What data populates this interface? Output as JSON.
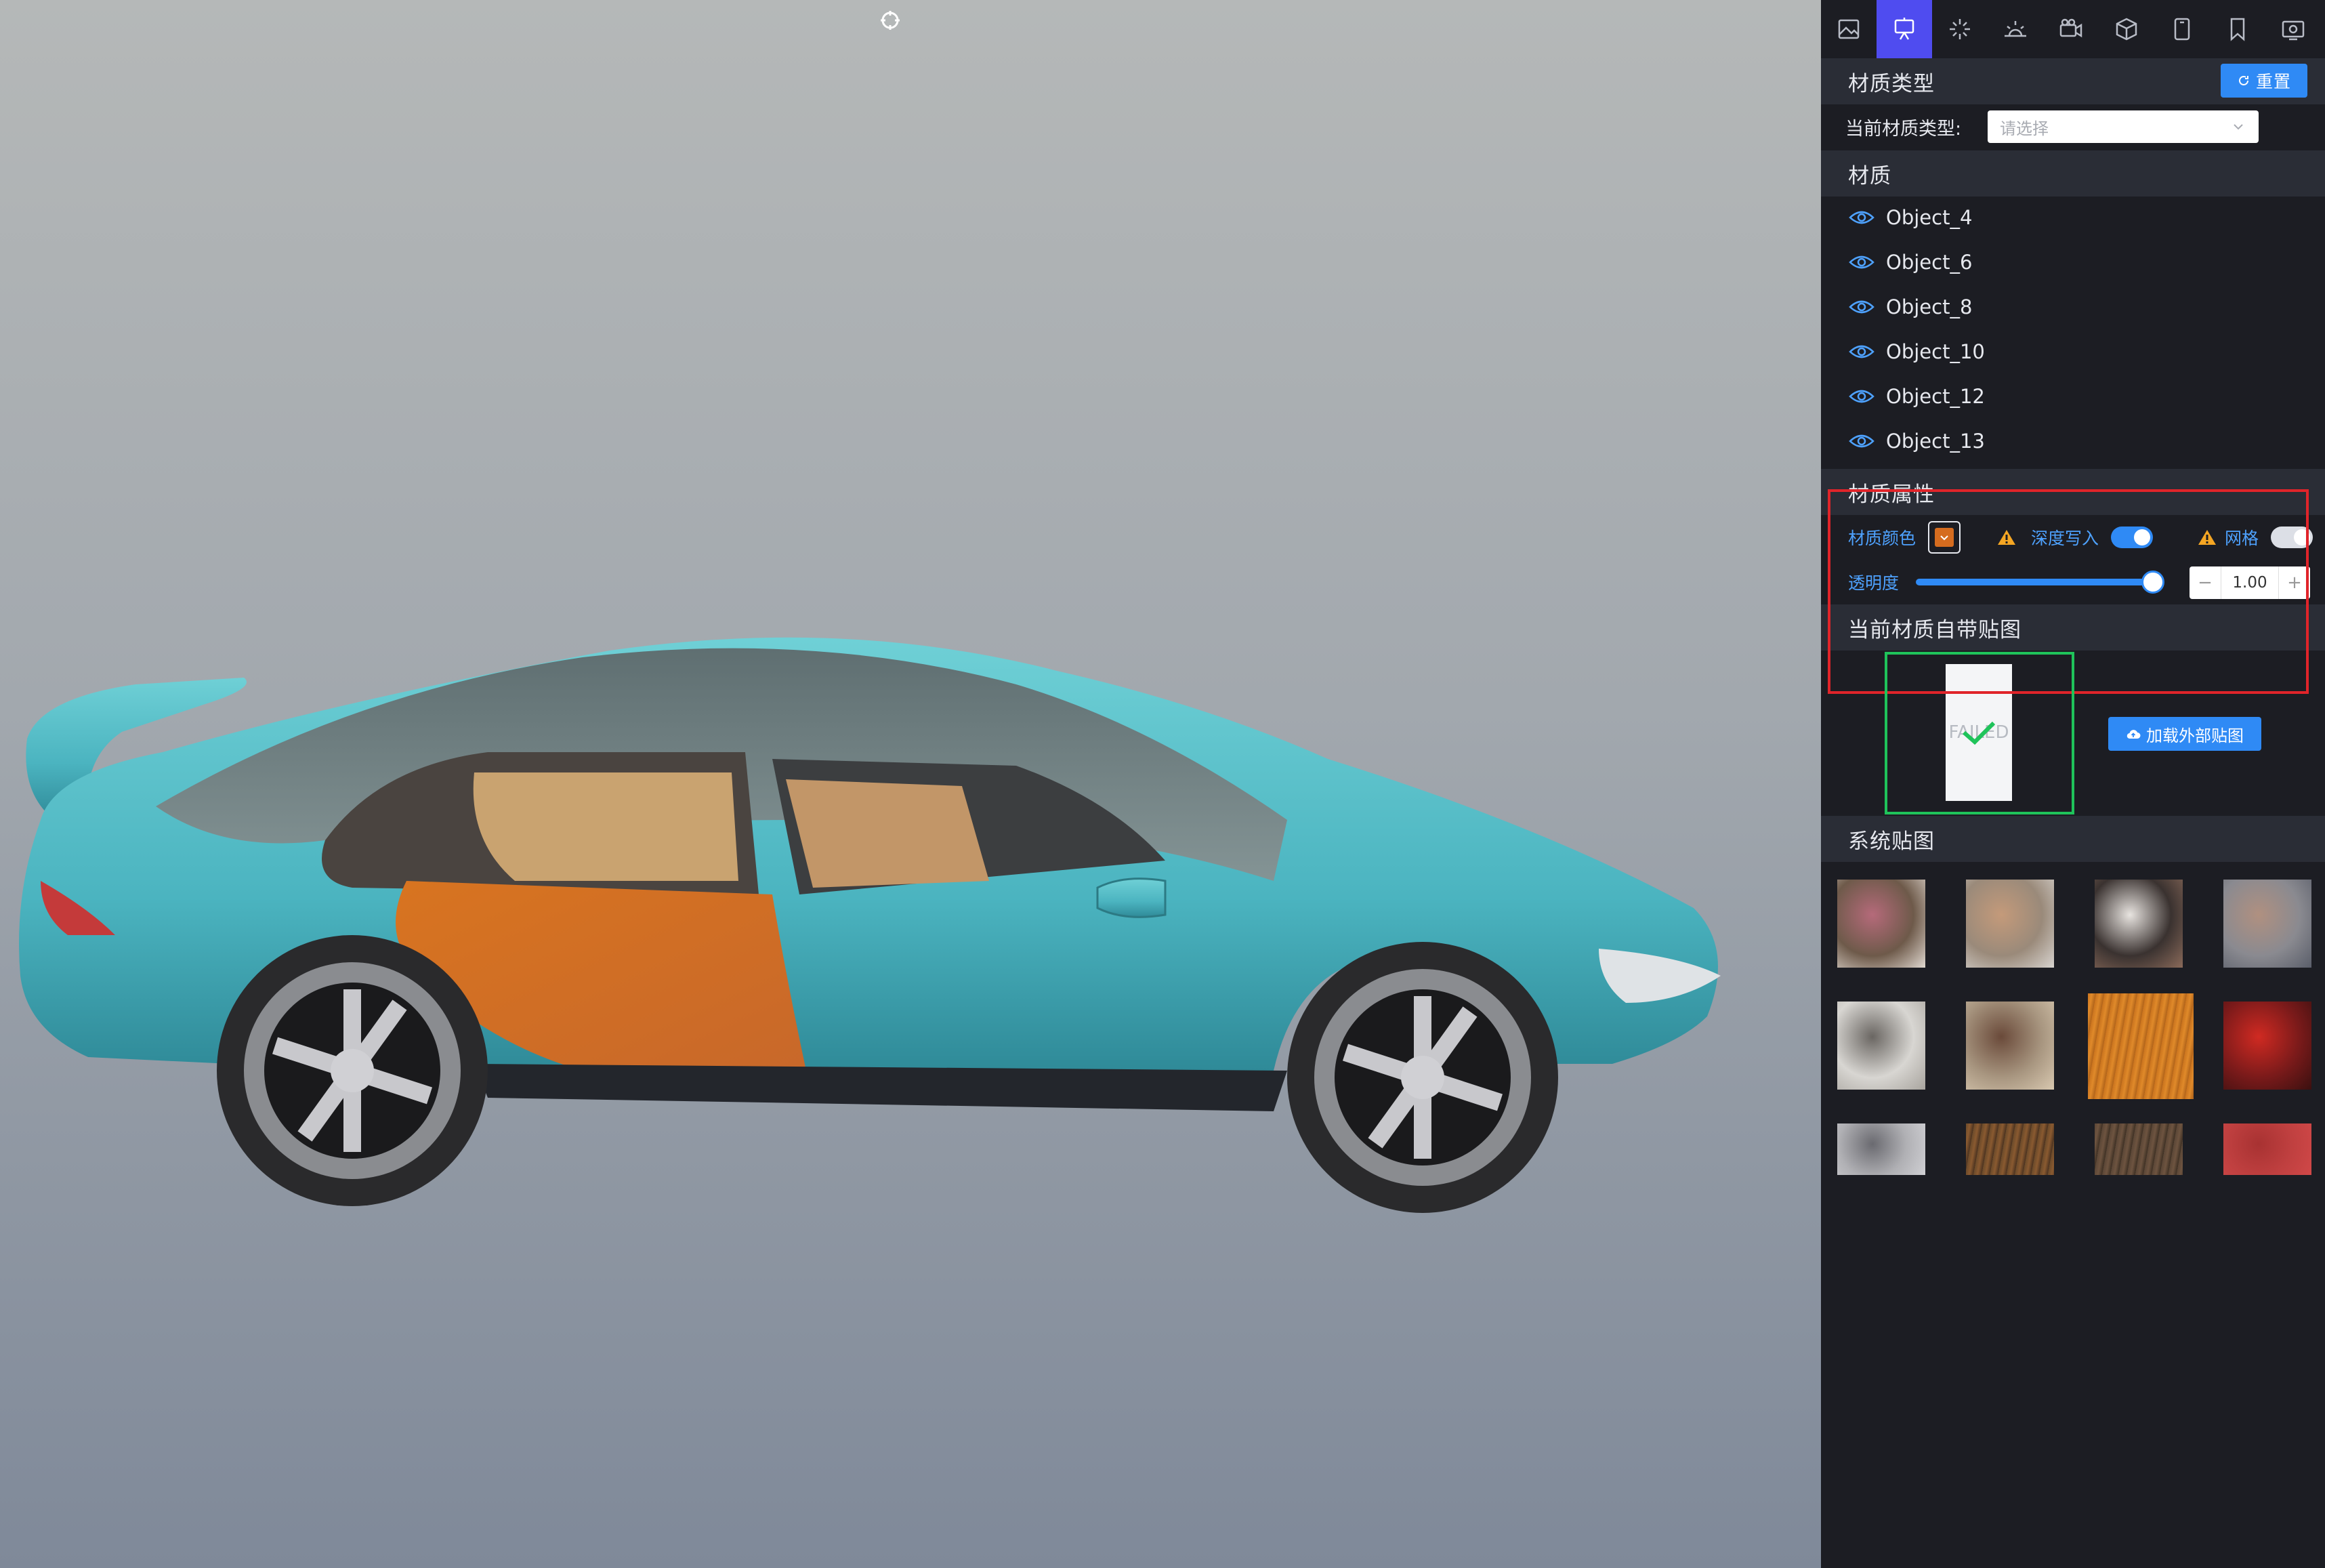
{
  "toolbar": {
    "icons": [
      "image-icon",
      "easel-icon",
      "sparkle-icon",
      "sunrise-icon",
      "camera-icon",
      "box-icon",
      "tablet-icon",
      "bookmark-icon",
      "screen-capture-icon"
    ],
    "active_index": 1
  },
  "material_type": {
    "header": "材质类型",
    "reset_label": "重置",
    "current_label": "当前材质类型:",
    "select_placeholder": "请选择"
  },
  "materials": {
    "header": "材质",
    "items": [
      "Object_4",
      "Object_6",
      "Object_8",
      "Object_10",
      "Object_12",
      "Object_13"
    ]
  },
  "material_props": {
    "header": "材质属性",
    "color_label": "材质颜色",
    "color_value": "#d56c1f",
    "depth_write_label": "深度写入",
    "depth_write_on": true,
    "wireframe_label": "网格",
    "wireframe_on": false,
    "opacity_label": "透明度",
    "opacity_value": "1.00",
    "opacity_fraction": 1.0
  },
  "current_texture": {
    "header": "当前材质自带贴图",
    "thumb_text": "FAILED",
    "load_button_label": "加载外部贴图"
  },
  "system_textures": {
    "header": "系统贴图",
    "items": [
      {
        "name": "flowers-bouquet",
        "colors": [
          "#6e5a4a",
          "#b56a7a",
          "#e0d8d0"
        ]
      },
      {
        "name": "angel-painting",
        "colors": [
          "#9a8a7a",
          "#c49a7a",
          "#d8d4d0"
        ]
      },
      {
        "name": "white-rose",
        "colors": [
          "#3a3230",
          "#e8e4e0",
          "#8a6a5a"
        ]
      },
      {
        "name": "bird-painting",
        "colors": [
          "#8a8a90",
          "#b09080",
          "#5a5e6a"
        ]
      },
      {
        "name": "ink-branches",
        "colors": [
          "#d8d6d2",
          "#6a6662",
          "#a8a49e"
        ]
      },
      {
        "name": "peony-still",
        "colors": [
          "#a89680",
          "#6a4a3a",
          "#d8c8b0"
        ]
      },
      {
        "name": "wood-orange",
        "colors": [
          "#c9731e",
          "#e08a2a",
          "#b0631a"
        ]
      },
      {
        "name": "red-fish",
        "colors": [
          "#7a1a1a",
          "#d02a22",
          "#3a1010"
        ]
      },
      {
        "name": "gray-forest",
        "colors": [
          "#b0b0b4",
          "#6a6a70",
          "#d0d0d4"
        ]
      },
      {
        "name": "wood-dark",
        "colors": [
          "#6a4a2a",
          "#8a5a30",
          "#4a3220"
        ]
      },
      {
        "name": "wood-brown",
        "colors": [
          "#5a4636",
          "#6e5440",
          "#3e3024"
        ]
      },
      {
        "name": "red-leather",
        "colors": [
          "#c04040",
          "#a83232",
          "#d04848"
        ]
      }
    ]
  }
}
